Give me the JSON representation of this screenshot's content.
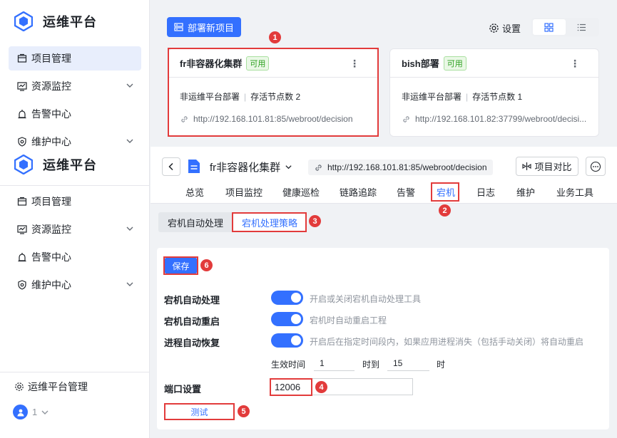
{
  "brand": {
    "title": "运维平台"
  },
  "sidebar_top": [
    {
      "label": "项目管理",
      "icon": "project-icon",
      "active": true
    },
    {
      "label": "资源监控",
      "icon": "monitor-icon",
      "chevron": true
    },
    {
      "label": "告警中心",
      "icon": "alarm-icon"
    },
    {
      "label": "维护中心",
      "icon": "maintain-icon",
      "chevron": true
    }
  ],
  "sidebar_bottom": [
    {
      "label": "项目管理",
      "icon": "project-icon"
    },
    {
      "label": "资源监控",
      "icon": "monitor-icon",
      "chevron": true
    },
    {
      "label": "告警中心",
      "icon": "alarm-icon"
    },
    {
      "label": "维护中心",
      "icon": "maintain-icon",
      "chevron": true
    }
  ],
  "footer": {
    "admin_label": "运维平台管理",
    "user_label": "1"
  },
  "top": {
    "deploy_label": "部署新项目",
    "settings_label": "设置"
  },
  "cards": [
    {
      "name": "fr非容器化集群",
      "status": "可用",
      "type": "非运维平台部署",
      "nodes": "存活节点数 2",
      "url": "http://192.168.101.81:85/webroot/decision"
    },
    {
      "name": "bish部署",
      "status": "可用",
      "type": "非运维平台部署",
      "nodes": "存活节点数 1",
      "url": "http://192.168.101.82:37799/webroot/decisi..."
    }
  ],
  "detail": {
    "title": "fr非容器化集群",
    "url": "http://192.168.101.81:85/webroot/decision",
    "compare_label": "项目对比",
    "tabs": [
      "总览",
      "项目监控",
      "健康巡检",
      "链路追踪",
      "告警",
      "宕机",
      "日志",
      "维护",
      "业务工具"
    ],
    "active_tab": "宕机"
  },
  "subtabs": {
    "auto": "宕机自动处理",
    "policy": "宕机处理策略"
  },
  "form": {
    "save_label": "保存",
    "rows": [
      {
        "label": "宕机自动处理",
        "hint": "开启或关闭宕机自动处理工具",
        "on": true
      },
      {
        "label": "宕机自动重启",
        "hint": "宕机时自动重启工程",
        "on": true
      },
      {
        "label": "进程自动恢复",
        "hint": "开启后在指定时间段内，如果应用进程消失（包括手动关闭）将自动重启",
        "on": true
      }
    ],
    "effective_label": "生效时间",
    "start_hour": "1",
    "to_label": "时到",
    "end_hour": "15",
    "hour_unit": "时",
    "port_label": "端口设置",
    "port_value": "12006",
    "test_label": "测试"
  },
  "markers": [
    "1",
    "2",
    "3",
    "4",
    "5",
    "6"
  ],
  "colors": {
    "primary": "#3370ff",
    "annotation": "#e23b3b",
    "success": "#2ea121"
  }
}
